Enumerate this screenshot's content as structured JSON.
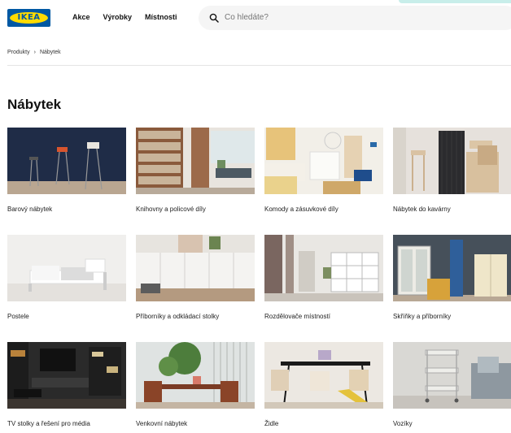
{
  "header": {
    "logo_text": "IKEA",
    "nav": [
      "Akce",
      "Výrobky",
      "Místnosti"
    ],
    "search_placeholder": "Co hledáte?"
  },
  "breadcrumb": [
    "Produkty",
    "Nábytek"
  ],
  "page_title": "Nábytek",
  "categories": [
    {
      "label": "Barový nábytek"
    },
    {
      "label": "Knihovny a policové díly"
    },
    {
      "label": "Komody a zásuvkové díly"
    },
    {
      "label": "Nábytek do kavárny"
    },
    {
      "label": "Postele"
    },
    {
      "label": "Příborníky a odkládací stolky"
    },
    {
      "label": "Rozdělovače místností"
    },
    {
      "label": "Skříňky a příborníky"
    },
    {
      "label": "TV stolky a řešení pro média"
    },
    {
      "label": "Venkovní nábytek"
    },
    {
      "label": "Židle"
    },
    {
      "label": "Vozíky"
    }
  ]
}
